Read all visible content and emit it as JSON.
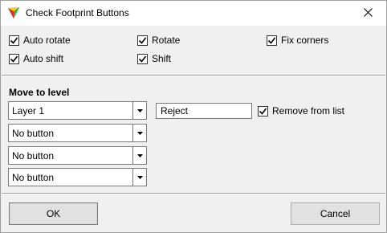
{
  "window": {
    "title": "Check Footprint Buttons",
    "close_label": "✕"
  },
  "options": {
    "auto_rotate": {
      "label": "Auto rotate",
      "checked": true
    },
    "rotate": {
      "label": "Rotate",
      "checked": true
    },
    "fix_corners": {
      "label": "Fix corners",
      "checked": true
    },
    "auto_shift": {
      "label": "Auto shift",
      "checked": true
    },
    "shift": {
      "label": "Shift",
      "checked": true
    }
  },
  "move_to_level": {
    "title": "Move to level",
    "combos": [
      {
        "value": "Layer 1"
      },
      {
        "value": "No button"
      },
      {
        "value": "No button"
      },
      {
        "value": "No button"
      }
    ],
    "reject_field": {
      "value": "Reject"
    },
    "remove_from_list": {
      "label": "Remove from list",
      "checked": true
    }
  },
  "footer": {
    "ok_label": "OK",
    "cancel_label": "Cancel"
  }
}
